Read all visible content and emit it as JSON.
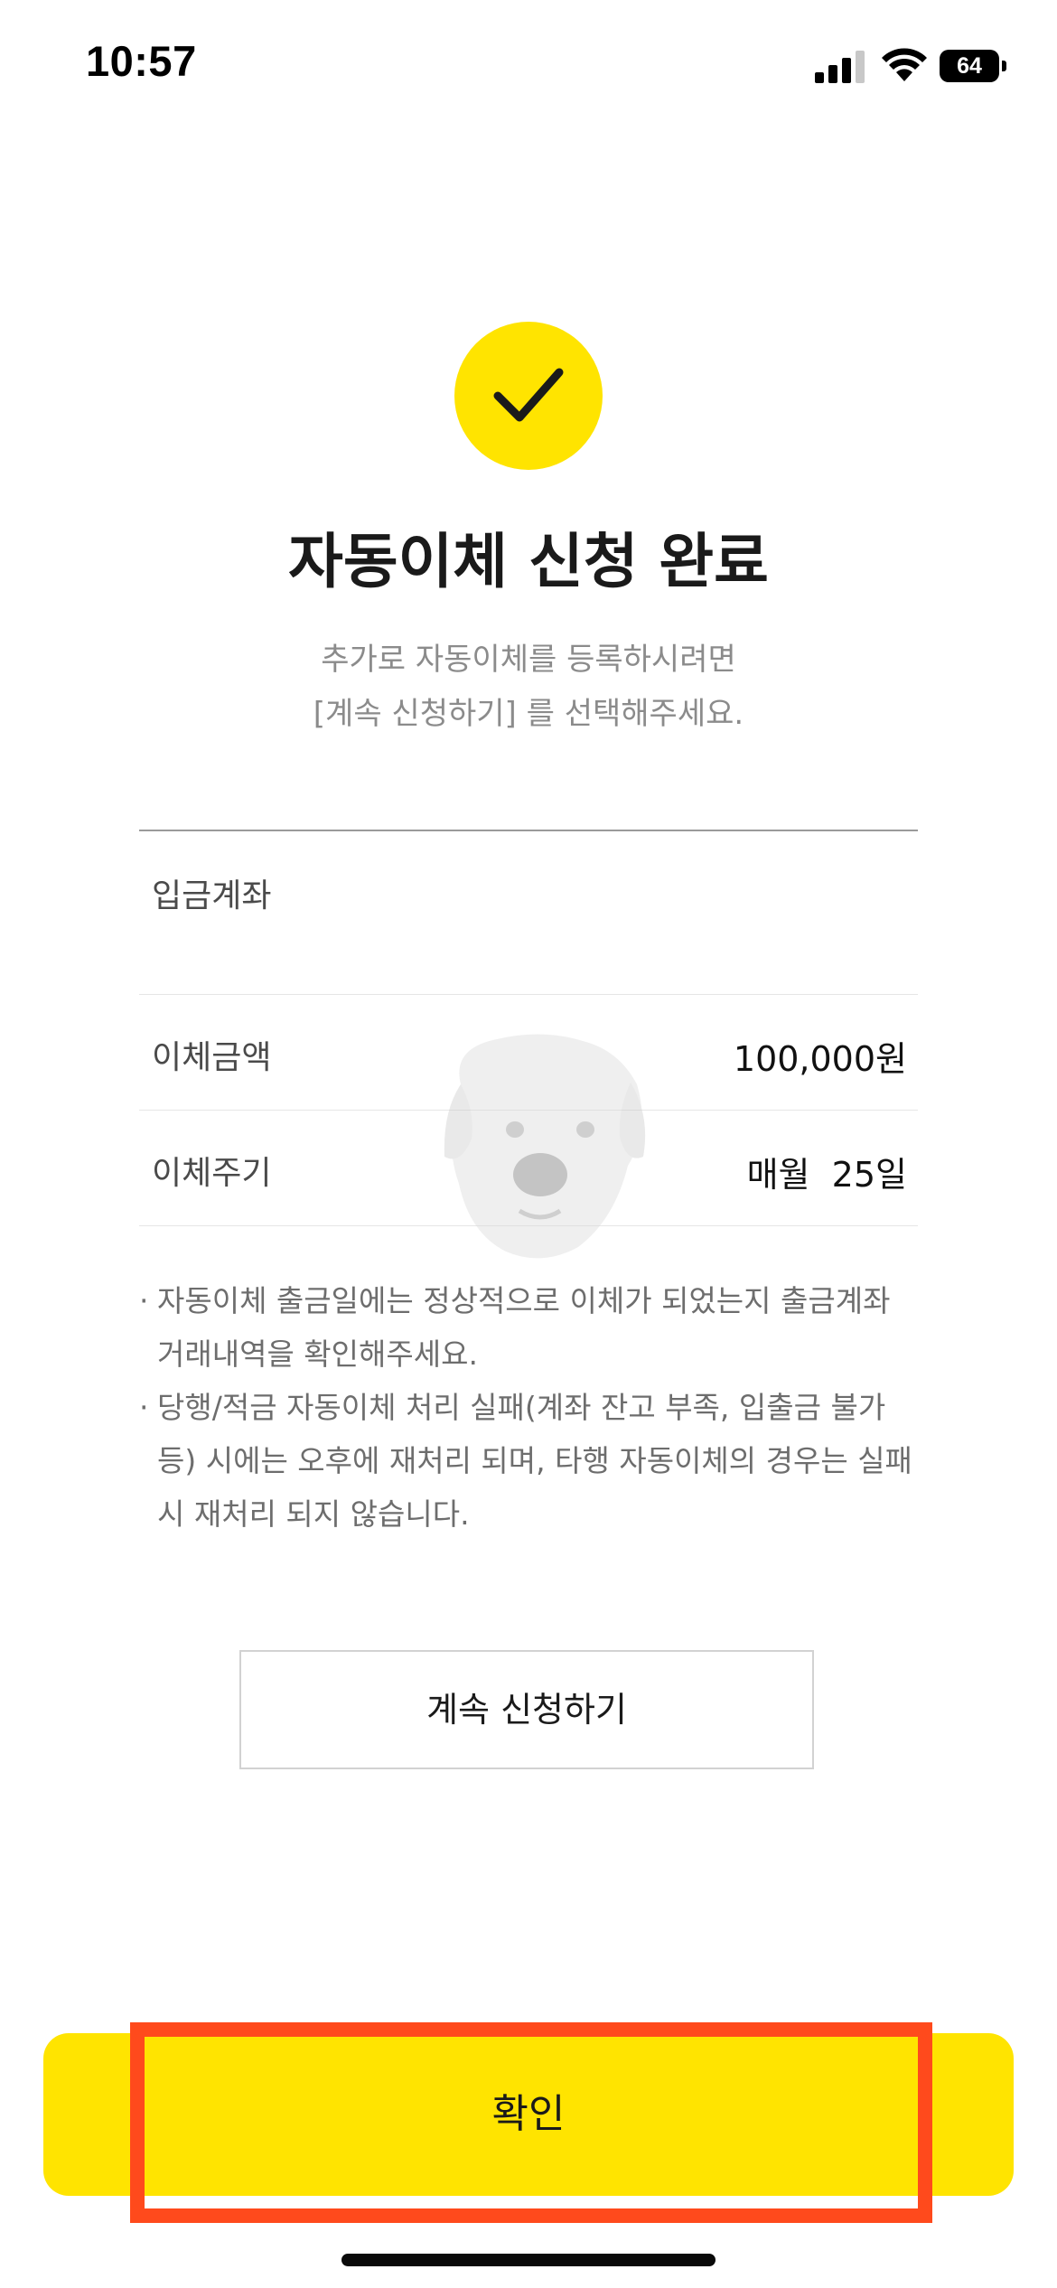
{
  "status_bar": {
    "time": "10:57",
    "battery_level": "64",
    "signal_icon": "cellular-signal-icon",
    "wifi_icon": "wifi-icon"
  },
  "header": {
    "icon": "check-icon",
    "title": "자동이체 신청 완료",
    "subtitle_line1": "추가로 자동이체를 등록하시려면",
    "subtitle_line2": "[계속 신청하기] 를 선택해주세요."
  },
  "details": {
    "account_label": "입금계좌",
    "account_value": "",
    "amount_label": "이체금액",
    "amount_value": "100,000원",
    "cycle_label": "이체주기",
    "cycle_value": "매월  25일"
  },
  "notes": [
    {
      "bullet": "·",
      "text": "자동이체 출금일에는 정상적으로 이체가 되었는지 출금계좌 거래내역을 확인해주세요."
    },
    {
      "bullet": "·",
      "text": "당행/적금 자동이체 처리 실패(계좌 잔고 부족, 입출금 불가 등) 시에는 오후에 재처리 되며, 타행 자동이체의 경우는 실패 시 재처리 되지 않습니다."
    }
  ],
  "buttons": {
    "continue_label": "계속 신청하기",
    "confirm_label": "확인"
  },
  "colors": {
    "accent_yellow": "#ffe400",
    "highlight_red": "#ff4a1c"
  }
}
